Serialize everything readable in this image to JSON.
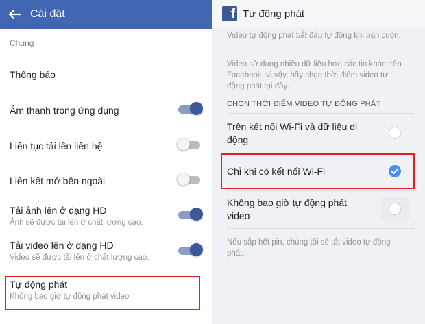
{
  "left": {
    "title": "Cài đặt",
    "section": "Chung",
    "rows": [
      {
        "title": "Thông báo"
      },
      {
        "title": "Âm thanh trong ứng dụng",
        "toggle": "on"
      },
      {
        "title": "Liên tục tải lên liên hệ",
        "toggle": "off"
      },
      {
        "title": "Liên kết mở bên ngoài",
        "toggle": "off"
      },
      {
        "title": "Tải ảnh lên ở dạng HD",
        "subtitle": "Ảnh sẽ được tải lên ở chất lượng cao.",
        "toggle": "on"
      },
      {
        "title": "Tải video lên ở dạng HD",
        "subtitle": "Video sẽ được tải lên ở chất lượng cao.",
        "toggle": "on"
      },
      {
        "title": "Tự động phát",
        "subtitle": "Không bao giờ tự động phát video"
      }
    ]
  },
  "right": {
    "title": "Tự động phát",
    "desc1": "Video tự động phát bắt đầu tự động khi bạn cuộn.",
    "desc2": "Video sử dụng nhiều dữ liệu hơn các tin khác trên Facebook, vì vậy, hãy chọn thời điểm video tự động phát tại đây.",
    "options_label": "CHỌN THỜI ĐIỂM VIDEO TỰ ĐỘNG PHÁT",
    "options": [
      {
        "label": "Trên kết nối Wi-Fi và dữ liệu di động",
        "selected": false
      },
      {
        "label": "Chỉ khi có kết nối Wi-Fi",
        "selected": true
      },
      {
        "label": "Không bao giờ tự động phát video",
        "selected": false
      }
    ],
    "footer": "Nếu sắp hết pin, chúng tôi sẽ tắt video tự động phát."
  },
  "colors": {
    "header_blue": "#4267b2",
    "toggle_on": "#3b5998",
    "radio_selected": "#4c8ff0",
    "highlight_red": "#e02020"
  },
  "icons": {
    "back": "arrow-left-icon",
    "logo": "facebook-logo-icon",
    "check": "check-icon"
  }
}
